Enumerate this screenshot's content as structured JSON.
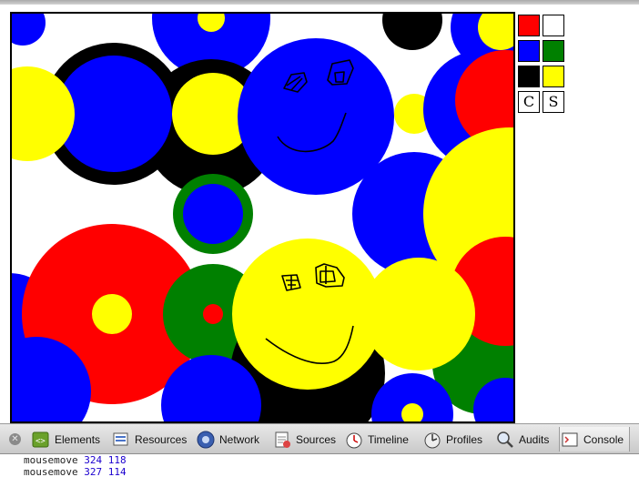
{
  "palette": {
    "swatches": [
      {
        "name": "red",
        "color": "#ff0000"
      },
      {
        "name": "white",
        "color": "#ffffff"
      },
      {
        "name": "blue",
        "color": "#0000ff"
      },
      {
        "name": "green",
        "color": "#008000"
      },
      {
        "name": "black",
        "color": "#000000"
      },
      {
        "name": "yellow",
        "color": "#ffff00"
      }
    ],
    "clear_label": "C",
    "save_label": "S"
  },
  "devtools": {
    "tabs": [
      {
        "label": "Elements",
        "icon": "elements-icon"
      },
      {
        "label": "Resources",
        "icon": "resources-icon"
      },
      {
        "label": "Network",
        "icon": "network-icon"
      },
      {
        "label": "Sources",
        "icon": "sources-icon"
      },
      {
        "label": "Timeline",
        "icon": "timeline-icon"
      },
      {
        "label": "Profiles",
        "icon": "profiles-icon"
      },
      {
        "label": "Audits",
        "icon": "audits-icon"
      },
      {
        "label": "Console",
        "icon": "console-icon"
      }
    ],
    "active_tab": "Console",
    "console_lines": [
      {
        "event": "mousemove",
        "x": "324",
        "y": "118"
      },
      {
        "event": "mousemove",
        "x": "327",
        "y": "114"
      }
    ]
  }
}
